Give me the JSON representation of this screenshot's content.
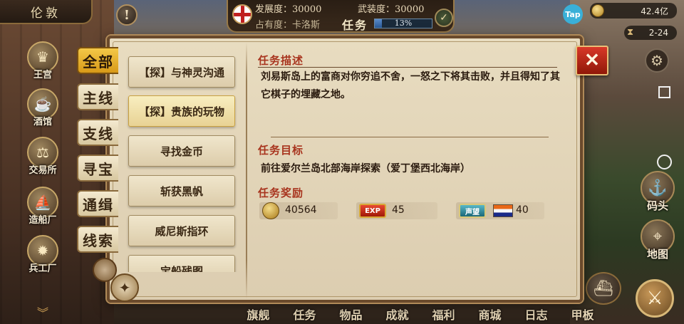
{
  "top": {
    "city": "伦敦",
    "development_label": "发展度：30000",
    "armament_label": "武装度：30000",
    "occupancy_label": "占有度：卡洛斯",
    "task_label": "任务",
    "progress_text": "13%",
    "progress_value": 0.13,
    "tap_label": "Tap",
    "gold": "42.4亿",
    "date": "2-24"
  },
  "left_menu": [
    {
      "label": "王宫",
      "icon": "crown-icon"
    },
    {
      "label": "酒馆",
      "icon": "tavern-icon"
    },
    {
      "label": "交易所",
      "icon": "scales-icon"
    },
    {
      "label": "造船厂",
      "icon": "ship-icon"
    },
    {
      "label": "兵工厂",
      "icon": "cannon-icon"
    }
  ],
  "right_menu": [
    {
      "label": "码头",
      "icon": "dock-icon"
    },
    {
      "label": "地图",
      "icon": "map-icon"
    }
  ],
  "bottom_nav": [
    "旗舰",
    "任务",
    "物品",
    "成就",
    "福利",
    "商城",
    "日志",
    "甲板"
  ],
  "categories": [
    {
      "label": "全部",
      "active": true
    },
    {
      "label": "主线",
      "active": false
    },
    {
      "label": "支线",
      "active": false
    },
    {
      "label": "寻宝",
      "active": false
    },
    {
      "label": "通缉",
      "active": false
    },
    {
      "label": "线索",
      "active": false
    }
  ],
  "tasks": [
    {
      "label": "【探】与神灵沟通",
      "selected": false
    },
    {
      "label": "【探】贵族的玩物",
      "selected": true
    },
    {
      "label": "寻找金币",
      "selected": false
    },
    {
      "label": "斩获黑帆",
      "selected": false
    },
    {
      "label": "威尼斯指环",
      "selected": false
    },
    {
      "label": "宝船残图",
      "selected": false
    }
  ],
  "detail": {
    "desc_title": "任务描述",
    "desc_text": "刘易斯岛上的富商对你穷追不舍，一怒之下将其击败，并且得知了其它棋子的埋藏之地。",
    "goal_title": "任务目标",
    "goal_text": "前往爱尔兰岛北部海岸探索（爱丁堡西北海岸）",
    "reward_title": "任务奖励",
    "reward_gold": "40564",
    "reward_exp_badge": "EXP",
    "reward_exp": "45",
    "reward_fame_badge": "声望",
    "reward_fame": "40"
  },
  "colors": {
    "accent_tab": "#d89a18",
    "section_title": "#a8341e",
    "close_button": "#d83828"
  }
}
